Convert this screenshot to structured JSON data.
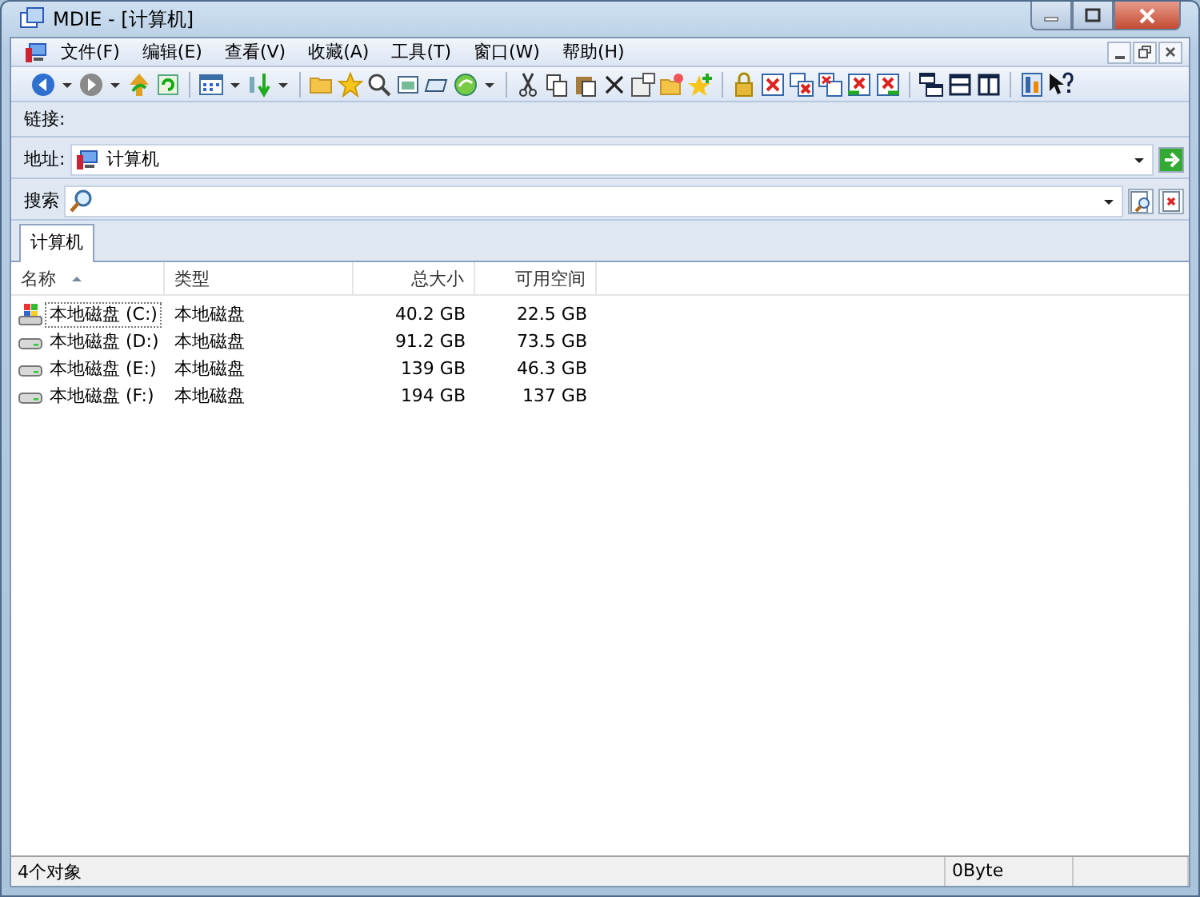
{
  "window": {
    "title": "MDIE - [计算机]"
  },
  "menu": [
    {
      "label": "文件(F)"
    },
    {
      "label": "编辑(E)"
    },
    {
      "label": "查看(V)"
    },
    {
      "label": "收藏(A)"
    },
    {
      "label": "工具(T)"
    },
    {
      "label": "窗口(W)"
    },
    {
      "label": "帮助(H)"
    }
  ],
  "links_bar": {
    "label": "链接:"
  },
  "address_bar": {
    "label": "地址:",
    "value": "计算机"
  },
  "search_bar": {
    "label": "搜索"
  },
  "tabs": [
    {
      "label": "计算机",
      "selected": true
    }
  ],
  "table": {
    "columns": [
      {
        "label": "名称",
        "sorted": true
      },
      {
        "label": "类型",
        "sorted": false
      },
      {
        "label": "总大小",
        "sorted": false
      },
      {
        "label": "可用空间",
        "sorted": false
      }
    ],
    "rows": [
      {
        "kind": "system",
        "name": "本地磁盘 (C:)",
        "type": "本地磁盘",
        "total": "40.2 GB",
        "free": "22.5 GB",
        "focused": true
      },
      {
        "kind": "drive",
        "name": "本地磁盘 (D:)",
        "type": "本地磁盘",
        "total": "91.2 GB",
        "free": "73.5 GB",
        "focused": false
      },
      {
        "kind": "drive",
        "name": "本地磁盘 (E:)",
        "type": "本地磁盘",
        "total": "139 GB",
        "free": "46.3 GB",
        "focused": false
      },
      {
        "kind": "drive",
        "name": "本地磁盘 (F:)",
        "type": "本地磁盘",
        "total": "194 GB",
        "free": "137 GB",
        "focused": false
      }
    ]
  },
  "status_bar": {
    "objects": "4个对象",
    "size": "0Byte"
  }
}
